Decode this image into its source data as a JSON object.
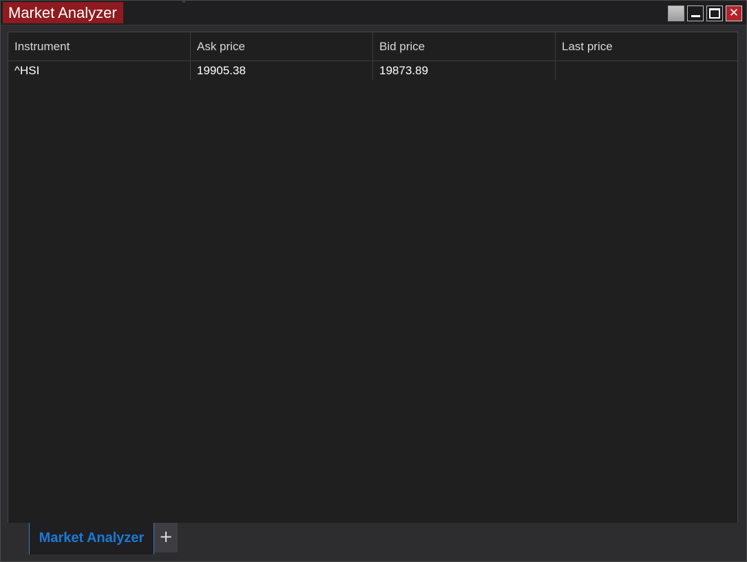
{
  "window": {
    "title": "Market Analyzer",
    "controls": {
      "close_glyph": "✕"
    }
  },
  "grid": {
    "columns": [
      "Instrument",
      "Ask price",
      "Bid price",
      "Last price"
    ],
    "rows": [
      {
        "instrument": "^HSI",
        "ask": "19905.38",
        "bid": "19873.89",
        "last": ""
      }
    ]
  },
  "tabs": {
    "items": [
      {
        "label": "Market Analyzer"
      }
    ],
    "add_label": "+"
  },
  "colors": {
    "title_accent": "#8e1b1f",
    "active_tab_text": "#1a7ad6",
    "close_button": "#b6222a"
  },
  "icons": [
    "window-options-icon",
    "minimize-icon",
    "maximize-icon",
    "close-icon",
    "add-tab-icon"
  ]
}
